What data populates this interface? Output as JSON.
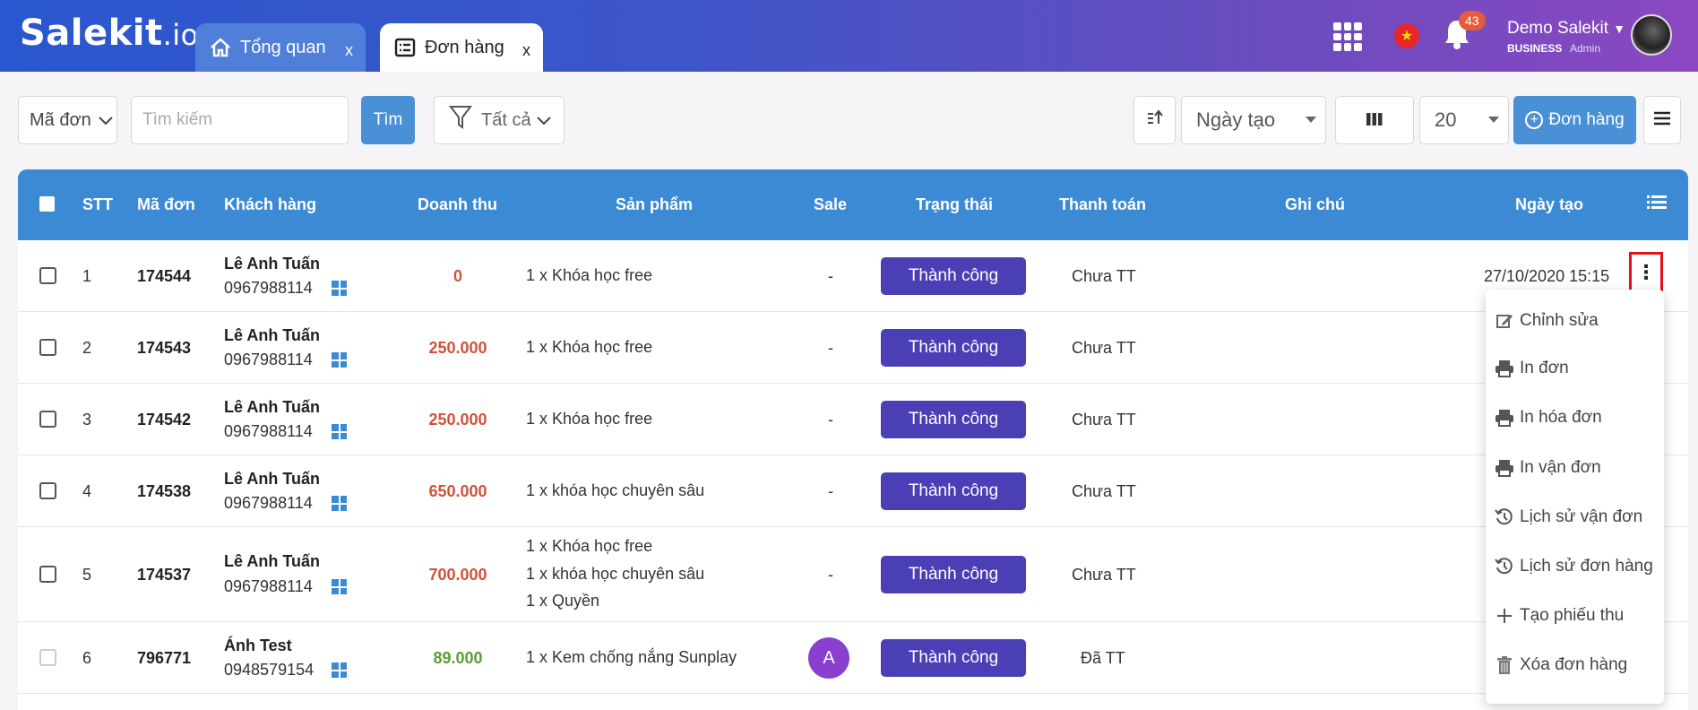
{
  "app": {
    "logo_main": "Salekit",
    "logo_suffix": ".io"
  },
  "tabs": [
    {
      "label": "Tổng quan",
      "close": "x"
    },
    {
      "label": "Đơn hàng",
      "close": "x"
    }
  ],
  "header": {
    "notifications_count": "43",
    "user_name": "Demo Salekit",
    "plan": "BUSINESS",
    "role": "Admin"
  },
  "toolbar": {
    "search_field": "Mã đơn",
    "search_placeholder": "Tìm kiếm",
    "search_button": "Tìm",
    "filter_label": "Tất cả",
    "sort_field": "Ngày tạo",
    "page_size": "20",
    "add_button": "Đơn hàng"
  },
  "table": {
    "headers": {
      "stt": "STT",
      "code": "Mã đơn",
      "customer": "Khách hàng",
      "revenue": "Doanh thu",
      "products": "Sản phẩm",
      "sale": "Sale",
      "status": "Trạng thái",
      "payment": "Thanh toán",
      "note": "Ghi chú",
      "created": "Ngày tạo"
    },
    "rows": [
      {
        "stt": "1",
        "code": "174544",
        "customer": "Lê Anh Tuấn",
        "phone": "0967988114",
        "revenue": "0",
        "revenue_color": "#d0533a",
        "products": [
          "1 x Khóa học free"
        ],
        "sale": "-",
        "status": "Thành công",
        "payment": "Chưa TT",
        "created": "27/10/2020 15:15"
      },
      {
        "stt": "2",
        "code": "174543",
        "customer": "Lê Anh Tuấn",
        "phone": "0967988114",
        "revenue": "250.000",
        "revenue_color": "#d0533a",
        "products": [
          "1 x Khóa học free"
        ],
        "sale": "-",
        "status": "Thành công",
        "payment": "Chưa TT",
        "created": ""
      },
      {
        "stt": "3",
        "code": "174542",
        "customer": "Lê Anh Tuấn",
        "phone": "0967988114",
        "revenue": "250.000",
        "revenue_color": "#d0533a",
        "products": [
          "1 x Khóa học free"
        ],
        "sale": "-",
        "status": "Thành công",
        "payment": "Chưa TT",
        "created": ""
      },
      {
        "stt": "4",
        "code": "174538",
        "customer": "Lê Anh Tuấn",
        "phone": "0967988114",
        "revenue": "650.000",
        "revenue_color": "#d0533a",
        "products": [
          "1 x khóa học chuyên sâu"
        ],
        "sale": "-",
        "status": "Thành công",
        "payment": "Chưa TT",
        "created": ""
      },
      {
        "stt": "5",
        "code": "174537",
        "customer": "Lê Anh Tuấn",
        "phone": "0967988114",
        "revenue": "700.000",
        "revenue_color": "#d0533a",
        "products": [
          "1 x Khóa học free",
          "1 x khóa học chuyên sâu",
          "1 x Quyền"
        ],
        "sale": "-",
        "status": "Thành công",
        "payment": "Chưa TT",
        "created": ""
      },
      {
        "stt": "6",
        "code": "796771",
        "customer": "Ánh Test",
        "phone": "0948579154",
        "revenue": "89.000",
        "revenue_color": "#5a9e35",
        "products": [
          "1 x Kem chống nắng Sunplay"
        ],
        "sale": "A",
        "status": "Thành công",
        "payment": "Đã TT",
        "created": ""
      }
    ]
  },
  "row_menu": {
    "items": [
      {
        "label": "Chỉnh sửa",
        "icon": "edit-icon"
      },
      {
        "label": "In đơn",
        "icon": "printer-icon"
      },
      {
        "label": "In hóa đơn",
        "icon": "printer-icon"
      },
      {
        "label": "In vận đơn",
        "icon": "printer-icon"
      },
      {
        "label": "Lịch sử vận đơn",
        "icon": "history-icon"
      },
      {
        "label": "Lịch sử đơn hàng",
        "icon": "history-icon"
      },
      {
        "label": "Tạo phiếu thu",
        "icon": "plus-icon"
      },
      {
        "label": "Xóa đơn hàng",
        "icon": "trash-icon"
      }
    ]
  },
  "colors": {
    "header_gradient_start": "#2a57cf",
    "header_gradient_end": "#8b47c0",
    "table_header": "#3d8ad4",
    "status_badge": "#4b3fb5",
    "primary_button": "#4a90d6",
    "highlight_border": "#e3101a"
  }
}
